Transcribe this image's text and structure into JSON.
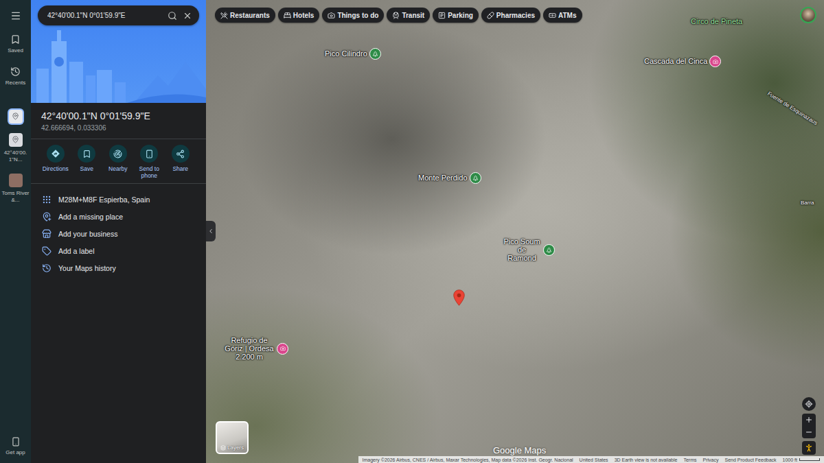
{
  "rail": {
    "items": [
      {
        "label": "Saved"
      },
      {
        "label": "Recents"
      }
    ],
    "pinned": {
      "selected": true
    },
    "recents": [
      {
        "label": "42°40'00.1\"N..."
      },
      {
        "label": "Toms River &..."
      }
    ],
    "footer": "Get app"
  },
  "search": {
    "value": "42°40'00.1\"N 0°01'59.9\"E"
  },
  "place": {
    "title": "42°40'00.1\"N 0°01'59.9\"E",
    "coordinates": "42.666694, 0.033306"
  },
  "actions": [
    {
      "label": "Directions"
    },
    {
      "label": "Save"
    },
    {
      "label": "Nearby"
    },
    {
      "label": "Send to phone"
    },
    {
      "label": "Share"
    }
  ],
  "details": [
    {
      "label": "M28M+M8F Espierba, Spain"
    },
    {
      "label": "Add a missing place"
    },
    {
      "label": "Add your business"
    },
    {
      "label": "Add a label"
    },
    {
      "label": "Your Maps history"
    }
  ],
  "map": {
    "chips": [
      {
        "label": "Restaurants"
      },
      {
        "label": "Hotels"
      },
      {
        "label": "Things to do"
      },
      {
        "label": "Transit"
      },
      {
        "label": "Parking"
      },
      {
        "label": "Pharmacies"
      },
      {
        "label": "ATMs"
      }
    ],
    "labels": [
      {
        "text": "Pico Cilindro",
        "kind": "peak"
      },
      {
        "text": "Monte Perdido",
        "kind": "peak"
      },
      {
        "text": "Pico Soum de Ramond",
        "kind": "peak"
      },
      {
        "text": "Cascada del Cinca",
        "kind": "poi"
      },
      {
        "text": "Circo de Pineta",
        "kind": "area"
      },
      {
        "text": "Refugio de Góriz | Ordesa 2.200 m",
        "kind": "poi"
      },
      {
        "text": "Fuente de Esquinazaus",
        "kind": "road"
      },
      {
        "text": "Barra",
        "kind": "road"
      }
    ],
    "layers_label": "Layers",
    "logo": "Google Maps",
    "attribution": [
      "Imagery ©2026 Airbus, CNES / Airbus, Maxar Technologies, Map data ©2026 Inst. Geogr. Nacional",
      "United States",
      "3D Earth view is not available",
      "Terms",
      "Privacy",
      "Send Product Feedback"
    ],
    "scale": "1000 ft"
  }
}
